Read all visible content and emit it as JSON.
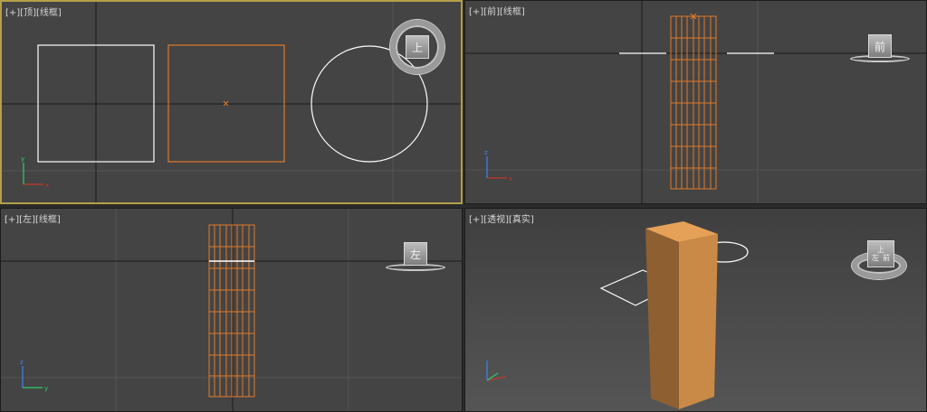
{
  "viewports": {
    "top": {
      "label_plus": "[+]",
      "label_view": "[顶]",
      "label_shade": "[线框]",
      "cube_face": "上"
    },
    "front": {
      "label_plus": "[+]",
      "label_view": "[前]",
      "label_shade": "[线框]",
      "cube_face": "前"
    },
    "left": {
      "label_plus": "[+]",
      "label_view": "[左]",
      "label_shade": "[线框]",
      "cube_face": "左"
    },
    "persp": {
      "label_plus": "[+]",
      "label_view": "[透视]",
      "label_shade": "[真实]",
      "cube_face_top": "上",
      "cube_face_left": "左",
      "cube_face_front": "前"
    }
  },
  "colors": {
    "viewport_bg": "#444444",
    "active_border": "#b3a04a",
    "grid_major": "#1a1a1a",
    "grid_minor": "#555555",
    "selected_wire": "#e07a2a",
    "white_wire": "#ffffff",
    "box_top": "#e6a158",
    "box_front": "#c98a48",
    "box_side": "#8e5f31"
  },
  "icons": {
    "axis_gizmo": "axis-gizmo-icon",
    "view_cube": "viewcube-icon",
    "pivot": "pivot-x-icon"
  }
}
